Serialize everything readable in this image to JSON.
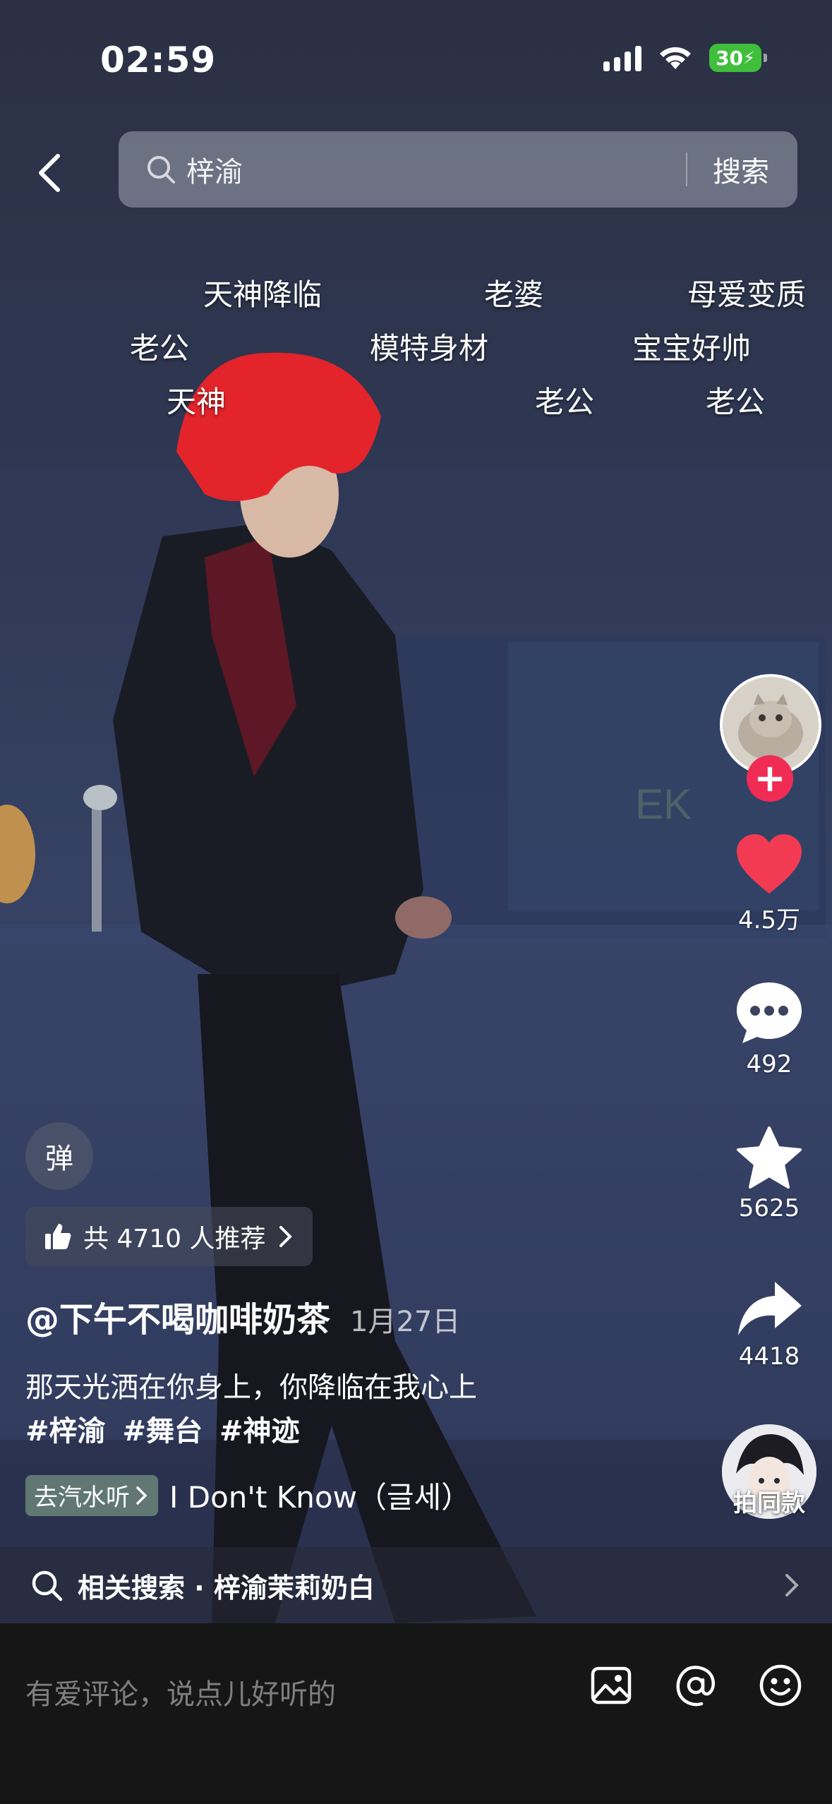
{
  "status_bar": {
    "time": "02:59",
    "battery": "30"
  },
  "search": {
    "query": "梓渝",
    "button_label": "搜索"
  },
  "danmaku": [
    "天神降临",
    "老婆",
    "母爱变质",
    "老公",
    "模特身材",
    "宝宝好帅",
    "天神",
    "老公",
    "老公"
  ],
  "actions": {
    "likes": "4.5万",
    "comments": "492",
    "favorites": "5625",
    "shares": "4418",
    "same_style_label": "拍同款"
  },
  "danmaku_toggle": "弹",
  "recommend": {
    "label": "共 4710 人推荐"
  },
  "post": {
    "author": "@下午不喝咖啡奶茶",
    "date": "1月27日",
    "caption": "那天光洒在你身上，你降临在我心上",
    "hashtags": [
      "#梓渝",
      "#舞台",
      "#神迹"
    ]
  },
  "music": {
    "tag_label": "去汽水听",
    "title": "I Don't Know（글세）"
  },
  "related": {
    "text": "相关搜索 · 梓渝茉莉奶白"
  },
  "comment": {
    "placeholder": "有爱评论，说点儿好听的"
  },
  "colors": {
    "like_red": "#f23b52",
    "follow_red": "#f02c55",
    "battery_green": "#3fbf3c",
    "comment_bar": "#161616"
  }
}
